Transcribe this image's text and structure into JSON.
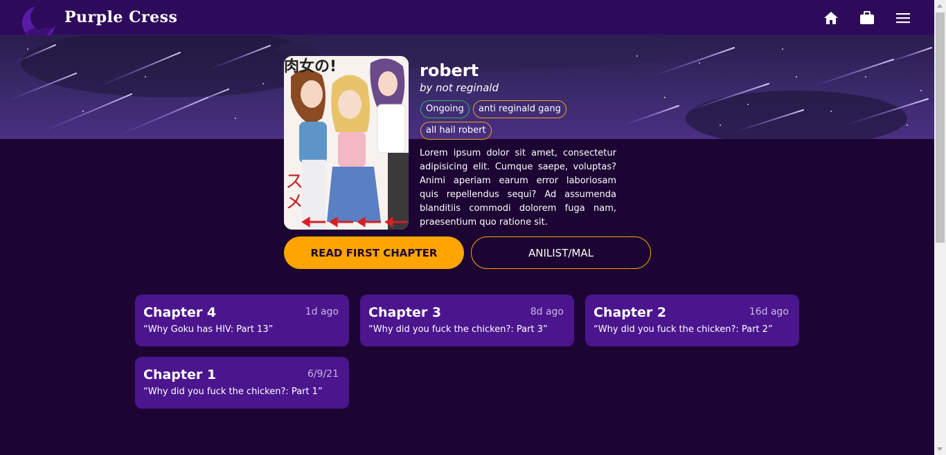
{
  "navbar": {
    "brand": "Purple Cress",
    "icons": [
      "home-icon",
      "briefcase-icon",
      "menu-icon"
    ]
  },
  "series": {
    "title": "robert",
    "author": "by not reginald",
    "tags": [
      "Ongoing",
      "anti reginald gang",
      "all hail robert"
    ],
    "description": "Lorem ipsum dolor sit amet, consectetur adipisicing elit. Cumque saepe, voluptas? Animi aperiam earum error laboriosam quis repellendus sequi? Ad assumenda blanditiis commodi dolorem fuga nam, praesentium quo ratione sit."
  },
  "buttons": {
    "read_first": "READ FIRST CHAPTER",
    "anilist": "ANILIST/MAL"
  },
  "chapters": [
    {
      "title": "Chapter 4",
      "date": "1d ago",
      "subtitle": "“Why Goku has HIV: Part 13”"
    },
    {
      "title": "Chapter 3",
      "date": "8d ago",
      "subtitle": "“Why did you fuck the chicken?: Part 3”"
    },
    {
      "title": "Chapter 2",
      "date": "16d ago",
      "subtitle": "“Why did you fuck the chicken?: Part 2”"
    },
    {
      "title": "Chapter 1",
      "date": "6/9/21",
      "subtitle": "“Why did you fuck the chicken?: Part 1”"
    }
  ],
  "colors": {
    "background": "#1c0533",
    "navbar": "#2e0a5a",
    "card": "#4b158e",
    "accent": "#ffa500",
    "status_green": "#2fb36b"
  }
}
